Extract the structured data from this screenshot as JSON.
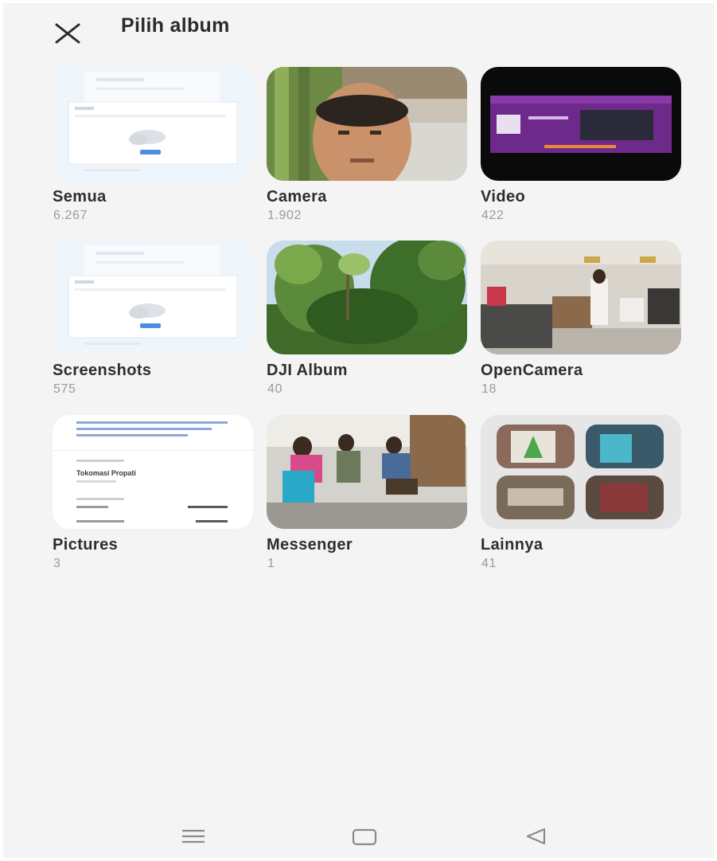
{
  "header": {
    "title": "Pilih album",
    "close_icon": "close-icon"
  },
  "albums": [
    {
      "name": "Semua",
      "count": "6.267"
    },
    {
      "name": "Camera",
      "count": "1.902"
    },
    {
      "name": "Video",
      "count": "422"
    },
    {
      "name": "Screenshots",
      "count": "575"
    },
    {
      "name": "DJI Album",
      "count": "40"
    },
    {
      "name": "OpenCamera",
      "count": "18"
    },
    {
      "name": "Pictures",
      "count": "3"
    },
    {
      "name": "Messenger",
      "count": "1"
    },
    {
      "name": "Lainnya",
      "count": "41"
    }
  ],
  "thumbnail_texts": {
    "pictures_heading": "Tokomasi Propati"
  },
  "navbar": {
    "icons": [
      "menu-icon",
      "home-icon",
      "back-icon"
    ]
  },
  "colors": {
    "background": "#f4f4f4",
    "title": "#2b2b2b",
    "count": "#9a9a9a"
  }
}
